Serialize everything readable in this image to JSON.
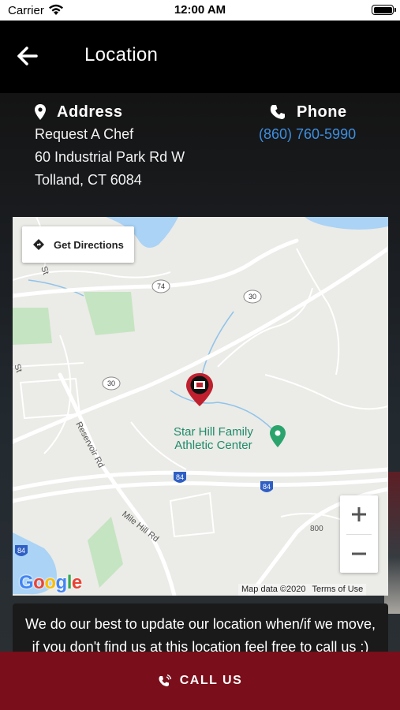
{
  "status_bar": {
    "carrier": "Carrier",
    "time": "12:00 AM"
  },
  "header": {
    "title": "Location",
    "back_icon": "arrow-left-icon"
  },
  "address": {
    "label": "Address",
    "icon": "map-marker-icon",
    "lines": [
      "Request A Chef",
      "60 Industrial Park Rd W",
      "Tolland, CT 6084"
    ]
  },
  "phone": {
    "label": "Phone",
    "icon": "phone-icon",
    "number": "(860) 760-5990",
    "link_color": "#3d8fe0"
  },
  "map": {
    "directions_label": "Get Directions",
    "poi": "Star Hill Family Athletic Center",
    "poi_line1": "Star Hill Family",
    "poi_line2": "Athletic Center",
    "road_labels": [
      "Reservoir Rd",
      "Mile Hill Rd",
      "St",
      "St"
    ],
    "route_shields": [
      "74",
      "30",
      "30",
      "84",
      "84",
      "84"
    ],
    "elevation": "800",
    "attribution": "Map data ©2020",
    "terms": "Terms of Use",
    "logo": "Google",
    "marker_color": "#c0202e"
  },
  "notice": "We do our best to update our location when/if we move, if you don't find us at this location feel free to call us :)",
  "call_button": {
    "label": "CALL US",
    "icon": "phone-volume-icon",
    "color": "#7a0e1a"
  }
}
